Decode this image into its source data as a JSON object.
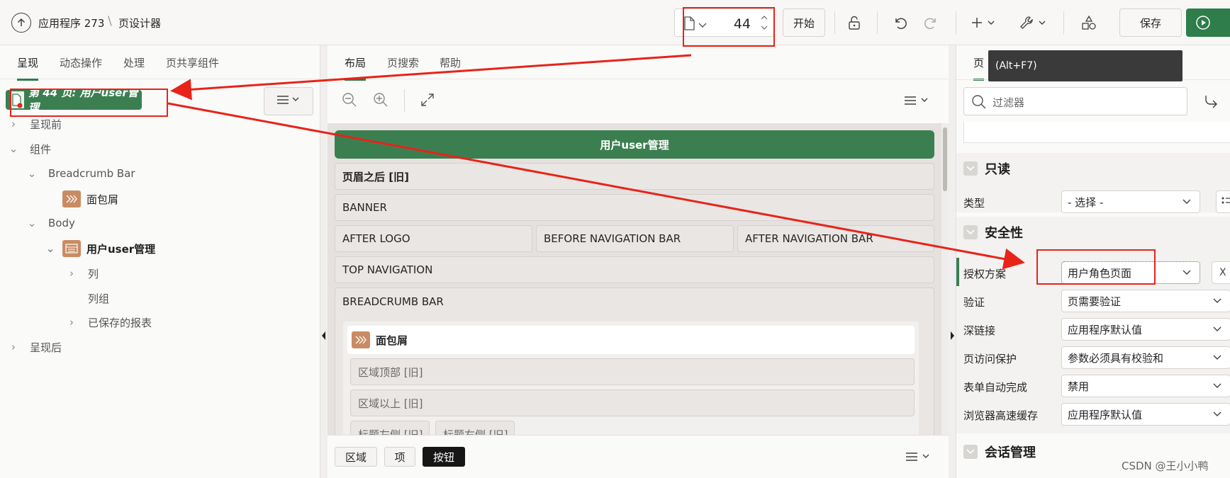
{
  "header": {
    "app_name": "应用程序 273",
    "separator": "\\",
    "page_name": "页设计器",
    "page_number": "44",
    "start_label": "开始",
    "save_label": "保存",
    "icons": [
      "arrow-up-icon",
      "page-icon",
      "lock-icon",
      "undo-icon",
      "redo-icon",
      "plus-icon",
      "wrench-icon",
      "shapes-icon",
      "play-icon"
    ]
  },
  "left_panel": {
    "tabs": [
      "呈现",
      "动态操作",
      "处理",
      "页共享组件"
    ],
    "root": "第 44 页: 用户user管理",
    "tree": {
      "pre_render": "呈现前",
      "components": "组件",
      "breadcrumb_bar": "Breadcrumb Bar",
      "breadcrumb": "面包屑",
      "body": "Body",
      "region": "用户user管理",
      "columns": "列",
      "column_groups": "列组",
      "saved_reports": "已保存的报表",
      "post_render": "呈现后"
    }
  },
  "middle_panel": {
    "tabs": [
      "布局",
      "页搜索",
      "帮助"
    ],
    "page_title": "用户user管理",
    "regions": {
      "after_header": "页眉之后 [旧]",
      "banner": "BANNER",
      "after_logo": "AFTER LOGO",
      "before_nav": "BEFORE NAVIGATION BAR",
      "after_nav": "AFTER NAVIGATION BAR",
      "top_nav": "TOP NAVIGATION",
      "breadcrumb_bar": "BREADCRUMB BAR",
      "breadcrumb": "面包屑",
      "region_top": "区域顶部 [旧]",
      "region_above": "区域以上 [旧]",
      "title_left": "标题左侧 [旧]",
      "title_right": "标题右侧 [旧]"
    },
    "bottom_tabs": [
      "区域",
      "项",
      "按钮"
    ]
  },
  "right_panel": {
    "tab_fragment": "页",
    "tooltip": "(Alt+F7)",
    "filter_placeholder": "过滤器",
    "sections": {
      "readonly": "只读",
      "security": "安全性",
      "session": "会话管理"
    },
    "props": {
      "type_label": "类型",
      "type_value": "- 选择 -",
      "auth_label": "授权方案",
      "auth_value": "用户角色页面",
      "auth_close": "X",
      "verify_label": "验证",
      "verify_value": "页需要验证",
      "deeplink_label": "深链接",
      "deeplink_value": "应用程序默认值",
      "access_label": "页访问保护",
      "access_value": "参数必须具有校验和",
      "autocomplete_label": "表单自动完成",
      "autocomplete_value": "禁用",
      "cache_label": "浏览器高速缓存",
      "cache_value": "应用程序默认值"
    }
  },
  "watermark": "CSDN @王小小鸭",
  "colors": {
    "accent": "#2e7d4a",
    "annotation": "#e8231a"
  }
}
